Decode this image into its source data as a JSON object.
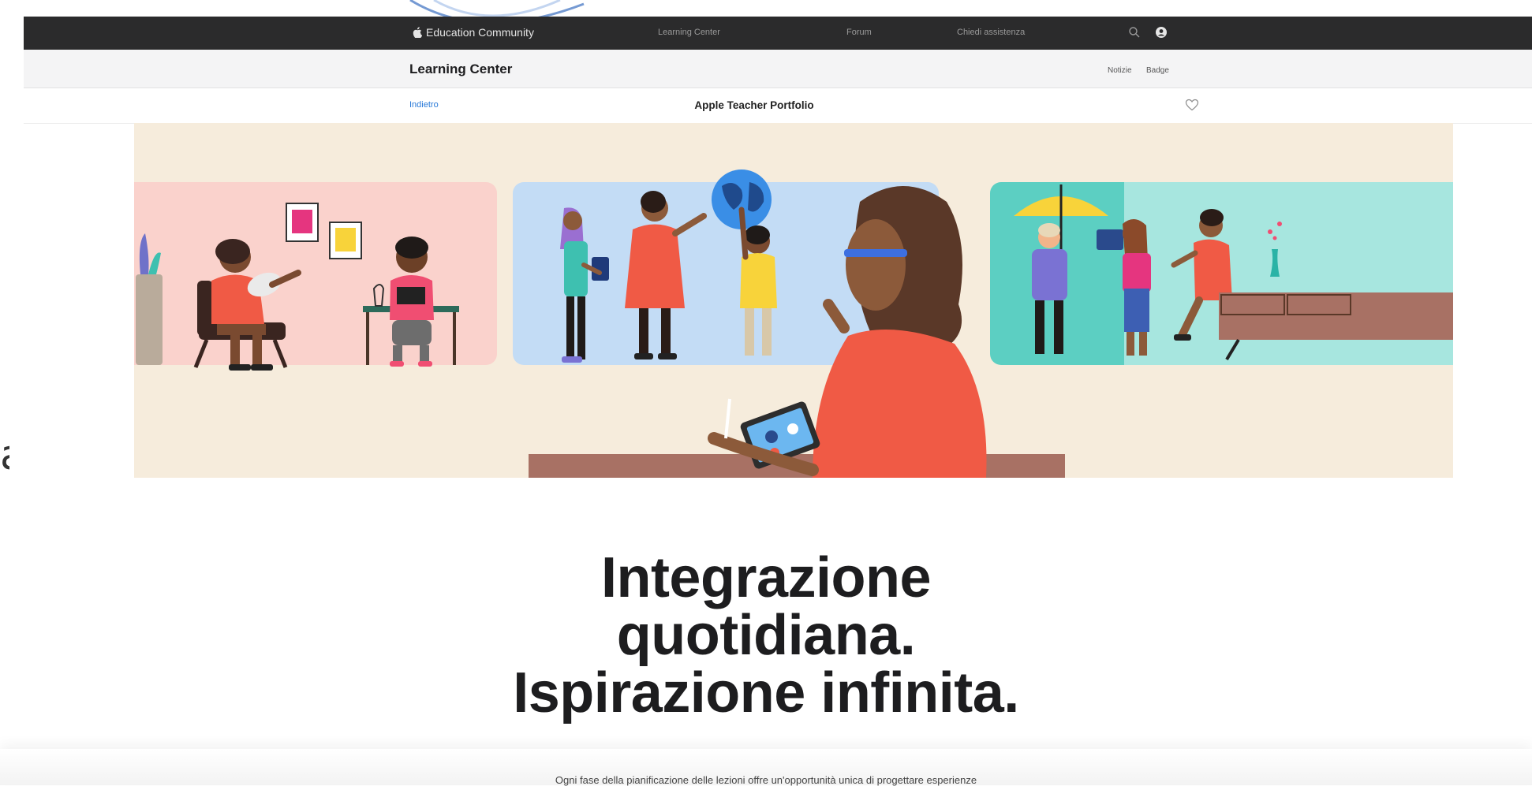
{
  "global_nav": {
    "brand": "Education Community",
    "links": [
      "Learning Center",
      "Forum",
      "Chiedi assistenza"
    ],
    "icons": [
      "search-icon",
      "account-icon"
    ]
  },
  "local_nav": {
    "title": "Learning Center",
    "links": [
      "Notizie",
      "Badge"
    ]
  },
  "sub_nav": {
    "back_label": "Indietro",
    "page_title": "Apple Teacher Portfolio",
    "icons": [
      "heart-icon"
    ]
  },
  "hero": {
    "scenes": [
      "classroom-reading-scene",
      "globe-discussion-scene",
      "umbrella-tablet-scene"
    ],
    "colors": {
      "background": "#f6ecdc",
      "panel_pink": "#fad2cc",
      "panel_blue": "#c3dcf5",
      "panel_teal": "#2cc0b4",
      "accent_orange": "#f05a45"
    }
  },
  "headline": {
    "line1": "Integrazione",
    "line2": "quotidiana.",
    "line3": "Ispirazione infinita."
  },
  "body_text": "Ogni fase della pianificazione delle lezioni offre un'opportunità unica di progettare esperienze",
  "left_edge_char": "a"
}
